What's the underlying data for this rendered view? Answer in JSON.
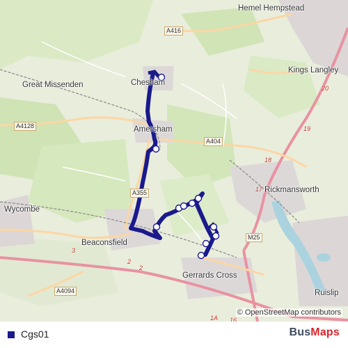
{
  "map": {
    "places": [
      "Hemel Hempstead",
      "Kings Langley",
      "Great Missenden",
      "Chesham",
      "Amersham",
      "Rickmansworth",
      "Wycombe",
      "Beaconsfield",
      "Gerrards Cross",
      "Ruislip"
    ],
    "road_labels": [
      "A416",
      "A4128",
      "A404",
      "A355",
      "M25",
      "A4094"
    ],
    "junction_labels": [
      "20",
      "19",
      "18",
      "17",
      "2",
      "2",
      "3",
      "1A",
      "16"
    ],
    "attribution": "© OpenStreetMap contributors"
  },
  "legend": {
    "route_name": "Cgs01",
    "route_color": "#1a1a8c"
  },
  "brand": {
    "part1": "Bus",
    "part2": "Maps"
  }
}
